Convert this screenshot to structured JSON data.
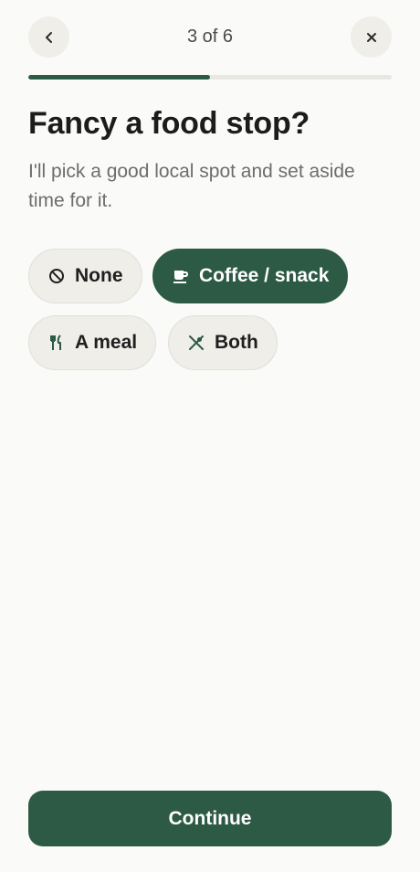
{
  "header": {
    "step_label": "3 of 6",
    "back_icon": "chevron-left-icon",
    "close_icon": "close-icon",
    "progress_fraction": 0.5
  },
  "question": {
    "title": "Fancy a food stop?",
    "subtitle": "I'll pick a good local spot and set aside time for it."
  },
  "options": [
    {
      "label": "None",
      "icon": "no-entry-icon",
      "selected": false
    },
    {
      "label": "Coffee / snack",
      "icon": "coffee-cup-icon",
      "selected": true
    },
    {
      "label": "A meal",
      "icon": "fork-knife-icon",
      "selected": false
    },
    {
      "label": "Both",
      "icon": "crossed-utensils-icon",
      "selected": false
    }
  ],
  "footer": {
    "continue_label": "Continue"
  },
  "colors": {
    "accent": "#2d5a45",
    "chip_background": "#efeee9",
    "page_background": "#fafaf8"
  }
}
